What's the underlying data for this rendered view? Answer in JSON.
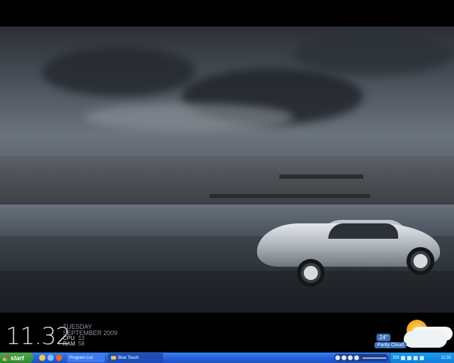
{
  "desktop": {
    "clock": {
      "time": "11.32",
      "day": "TUESDAY",
      "date": "SEPTEMBER 2009",
      "cpu_label": "CPU",
      "cpu_value": "13",
      "ram_label": "RAM",
      "ram_value": "58"
    },
    "weather": {
      "temperature": "24°",
      "condition": "Partly Cloud"
    }
  },
  "taskbar": {
    "start_label": "start",
    "tasks": [
      {
        "label": "Program List"
      },
      {
        "label": "Blue Touch"
      }
    ],
    "tray": {
      "language": "EN",
      "time": "11:32"
    }
  },
  "colors": {
    "taskbar_blue": "#2462da",
    "start_green": "#3a9a3a",
    "tray_blue": "#1b9bf0"
  }
}
